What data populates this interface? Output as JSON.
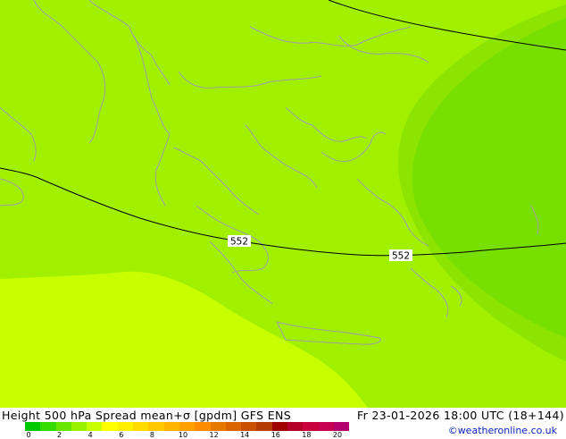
{
  "map": {
    "contour_labels": [
      "552",
      "552"
    ],
    "fill_colors": {
      "light_green": "#a0f000",
      "medium_green": "#8ce400",
      "dark_green": "#78e000",
      "yellow_green": "#c8ff00"
    },
    "coastline_color": "#a0a0a0"
  },
  "footer": {
    "title": "Height 500 hPa Spread mean+σ [gpdm] GFS ENS",
    "run": "Fr 23-01-2026 18:00 UTC (18+144)",
    "credit": "©weatheronline.co.uk",
    "colorbar_colors": [
      "#00c800",
      "#32dc00",
      "#64e600",
      "#96f000",
      "#c8ff00",
      "#ffff00",
      "#fff000",
      "#ffdc00",
      "#ffc800",
      "#ffb400",
      "#ffa000",
      "#ff8c00",
      "#e67800",
      "#dc6400",
      "#c85000",
      "#b43c00",
      "#a00000",
      "#b40028",
      "#c8003c",
      "#c80050",
      "#b4006e"
    ],
    "colorbar_ticks": [
      "0",
      "2",
      "4",
      "6",
      "8",
      "10",
      "12",
      "14",
      "16",
      "18",
      "20"
    ]
  }
}
